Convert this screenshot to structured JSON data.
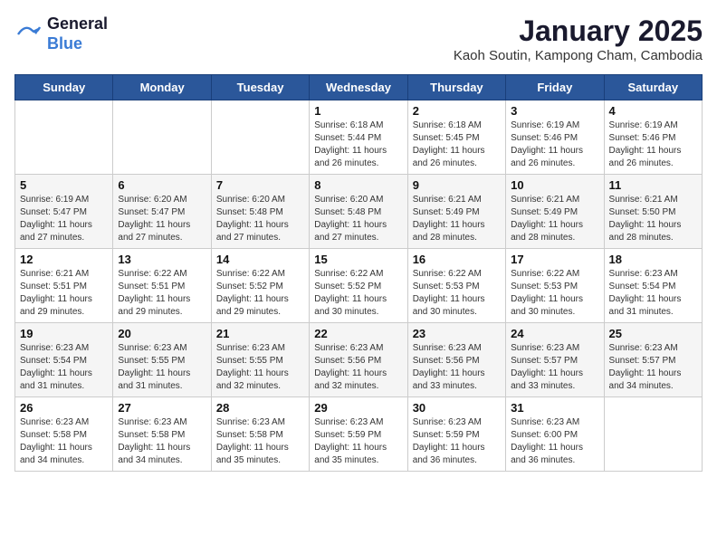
{
  "header": {
    "logo_line1": "General",
    "logo_line2": "Blue",
    "month_title": "January 2025",
    "location": "Kaoh Soutin, Kampong Cham, Cambodia"
  },
  "days_of_week": [
    "Sunday",
    "Monday",
    "Tuesday",
    "Wednesday",
    "Thursday",
    "Friday",
    "Saturday"
  ],
  "weeks": [
    [
      {
        "day": "",
        "info": ""
      },
      {
        "day": "",
        "info": ""
      },
      {
        "day": "",
        "info": ""
      },
      {
        "day": "1",
        "info": "Sunrise: 6:18 AM\nSunset: 5:44 PM\nDaylight: 11 hours\nand 26 minutes."
      },
      {
        "day": "2",
        "info": "Sunrise: 6:18 AM\nSunset: 5:45 PM\nDaylight: 11 hours\nand 26 minutes."
      },
      {
        "day": "3",
        "info": "Sunrise: 6:19 AM\nSunset: 5:46 PM\nDaylight: 11 hours\nand 26 minutes."
      },
      {
        "day": "4",
        "info": "Sunrise: 6:19 AM\nSunset: 5:46 PM\nDaylight: 11 hours\nand 26 minutes."
      }
    ],
    [
      {
        "day": "5",
        "info": "Sunrise: 6:19 AM\nSunset: 5:47 PM\nDaylight: 11 hours\nand 27 minutes."
      },
      {
        "day": "6",
        "info": "Sunrise: 6:20 AM\nSunset: 5:47 PM\nDaylight: 11 hours\nand 27 minutes."
      },
      {
        "day": "7",
        "info": "Sunrise: 6:20 AM\nSunset: 5:48 PM\nDaylight: 11 hours\nand 27 minutes."
      },
      {
        "day": "8",
        "info": "Sunrise: 6:20 AM\nSunset: 5:48 PM\nDaylight: 11 hours\nand 27 minutes."
      },
      {
        "day": "9",
        "info": "Sunrise: 6:21 AM\nSunset: 5:49 PM\nDaylight: 11 hours\nand 28 minutes."
      },
      {
        "day": "10",
        "info": "Sunrise: 6:21 AM\nSunset: 5:49 PM\nDaylight: 11 hours\nand 28 minutes."
      },
      {
        "day": "11",
        "info": "Sunrise: 6:21 AM\nSunset: 5:50 PM\nDaylight: 11 hours\nand 28 minutes."
      }
    ],
    [
      {
        "day": "12",
        "info": "Sunrise: 6:21 AM\nSunset: 5:51 PM\nDaylight: 11 hours\nand 29 minutes."
      },
      {
        "day": "13",
        "info": "Sunrise: 6:22 AM\nSunset: 5:51 PM\nDaylight: 11 hours\nand 29 minutes."
      },
      {
        "day": "14",
        "info": "Sunrise: 6:22 AM\nSunset: 5:52 PM\nDaylight: 11 hours\nand 29 minutes."
      },
      {
        "day": "15",
        "info": "Sunrise: 6:22 AM\nSunset: 5:52 PM\nDaylight: 11 hours\nand 30 minutes."
      },
      {
        "day": "16",
        "info": "Sunrise: 6:22 AM\nSunset: 5:53 PM\nDaylight: 11 hours\nand 30 minutes."
      },
      {
        "day": "17",
        "info": "Sunrise: 6:22 AM\nSunset: 5:53 PM\nDaylight: 11 hours\nand 30 minutes."
      },
      {
        "day": "18",
        "info": "Sunrise: 6:23 AM\nSunset: 5:54 PM\nDaylight: 11 hours\nand 31 minutes."
      }
    ],
    [
      {
        "day": "19",
        "info": "Sunrise: 6:23 AM\nSunset: 5:54 PM\nDaylight: 11 hours\nand 31 minutes."
      },
      {
        "day": "20",
        "info": "Sunrise: 6:23 AM\nSunset: 5:55 PM\nDaylight: 11 hours\nand 31 minutes."
      },
      {
        "day": "21",
        "info": "Sunrise: 6:23 AM\nSunset: 5:55 PM\nDaylight: 11 hours\nand 32 minutes."
      },
      {
        "day": "22",
        "info": "Sunrise: 6:23 AM\nSunset: 5:56 PM\nDaylight: 11 hours\nand 32 minutes."
      },
      {
        "day": "23",
        "info": "Sunrise: 6:23 AM\nSunset: 5:56 PM\nDaylight: 11 hours\nand 33 minutes."
      },
      {
        "day": "24",
        "info": "Sunrise: 6:23 AM\nSunset: 5:57 PM\nDaylight: 11 hours\nand 33 minutes."
      },
      {
        "day": "25",
        "info": "Sunrise: 6:23 AM\nSunset: 5:57 PM\nDaylight: 11 hours\nand 34 minutes."
      }
    ],
    [
      {
        "day": "26",
        "info": "Sunrise: 6:23 AM\nSunset: 5:58 PM\nDaylight: 11 hours\nand 34 minutes."
      },
      {
        "day": "27",
        "info": "Sunrise: 6:23 AM\nSunset: 5:58 PM\nDaylight: 11 hours\nand 34 minutes."
      },
      {
        "day": "28",
        "info": "Sunrise: 6:23 AM\nSunset: 5:58 PM\nDaylight: 11 hours\nand 35 minutes."
      },
      {
        "day": "29",
        "info": "Sunrise: 6:23 AM\nSunset: 5:59 PM\nDaylight: 11 hours\nand 35 minutes."
      },
      {
        "day": "30",
        "info": "Sunrise: 6:23 AM\nSunset: 5:59 PM\nDaylight: 11 hours\nand 36 minutes."
      },
      {
        "day": "31",
        "info": "Sunrise: 6:23 AM\nSunset: 6:00 PM\nDaylight: 11 hours\nand 36 minutes."
      },
      {
        "day": "",
        "info": ""
      }
    ]
  ]
}
